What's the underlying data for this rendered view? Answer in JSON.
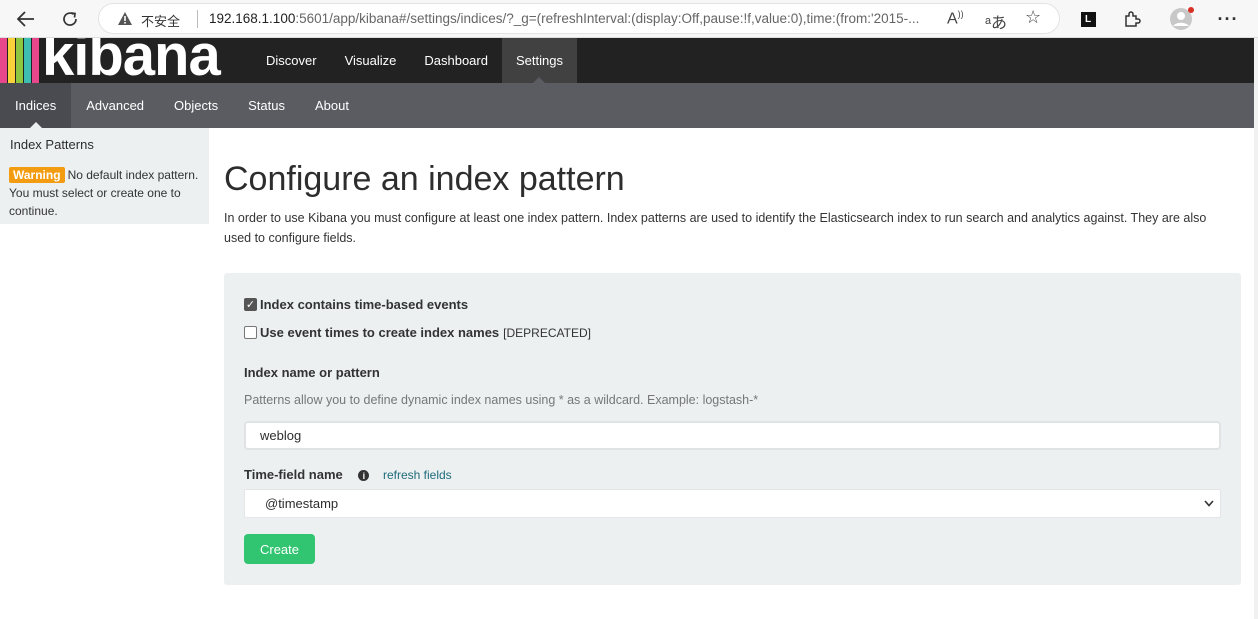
{
  "browser": {
    "insecure_label": "不安全",
    "url_host": "192.168.1.100",
    "url_rest": ":5601/app/kibana#/settings/indices/?_g=(refreshInterval:(display:Off,pause:!f,value:0),time:(from:'2015-...",
    "icons": [
      "back-icon",
      "reload-icon",
      "read-aloud-icon",
      "translate-icon",
      "favorite-icon",
      "extension-l-icon",
      "extensions-icon",
      "profile-icon",
      "more-icon"
    ]
  },
  "header": {
    "logo_text": "kibana",
    "logo_stripe_colors": [
      "#e8488b",
      "#f9d13a",
      "#8dc63f",
      "#3ebeb0",
      "#e8488b"
    ],
    "nav": [
      {
        "label": "Discover"
      },
      {
        "label": "Visualize"
      },
      {
        "label": "Dashboard"
      },
      {
        "label": "Settings",
        "active": true
      }
    ]
  },
  "subnav": [
    {
      "label": "Indices",
      "active": true
    },
    {
      "label": "Advanced"
    },
    {
      "label": "Objects"
    },
    {
      "label": "Status"
    },
    {
      "label": "About"
    }
  ],
  "sidebar": {
    "title": "Index Patterns",
    "warning_badge": "Warning",
    "warning_text": "No default index pattern. You must select or create one to continue."
  },
  "main": {
    "title": "Configure an index pattern",
    "description": "In order to use Kibana you must configure at least one index pattern. Index patterns are used to identify the Elasticsearch index to run search and analytics against. They are also used to configure fields.",
    "time_based_label": "Index contains time-based events",
    "time_based_checked": true,
    "event_times_label": "Use event times to create index names",
    "event_times_suffix": "[DEPRECATED]",
    "event_times_checked": false,
    "index_label": "Index name or pattern",
    "index_help": "Patterns allow you to define dynamic index names using * as a wildcard. Example: logstash-*",
    "index_value": "weblog",
    "time_field_label": "Time-field name",
    "refresh_fields_label": "refresh fields",
    "time_field_value": "@timestamp",
    "create_label": "Create"
  },
  "colors": {
    "header_bg": "#222222",
    "subnav_bg": "#5b5c62",
    "panel_bg": "#ecf0f1",
    "warning": "#f39c12",
    "create_button": "#31c471"
  }
}
